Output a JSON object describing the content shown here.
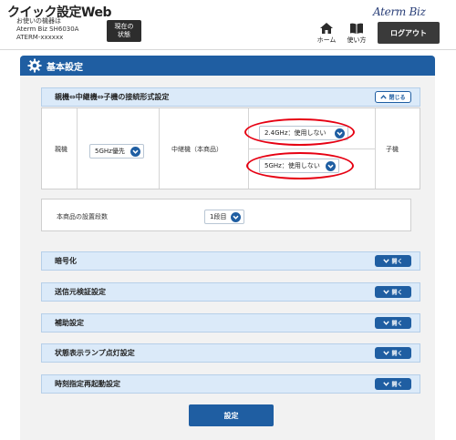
{
  "header": {
    "app_title": "クイック設定Web",
    "device_lines": [
      "お使いの機器は",
      "Aterm Biz SH6030A",
      "ATERM-xxxxxx"
    ],
    "status_button": [
      "現在の",
      "状態"
    ],
    "home_label": "ホーム",
    "manual_label": "使い方",
    "logout_label": "ログアウト",
    "brand": "Aterm Biz"
  },
  "section": {
    "title": "基本設定"
  },
  "connection": {
    "title": "親機⇔中継機⇔子機の接続形式設定",
    "close_label": "閉じる",
    "parent_label": "親機",
    "parent_select": "5GHz優先",
    "repeater_label": "中継機（本商品）",
    "band24_select": "2.4GHz：使用しない",
    "band5_select": "5GHz：使用しない",
    "child_label": "子機"
  },
  "stages": {
    "label": "本商品の設置段数",
    "select": "1段目"
  },
  "accordions": [
    {
      "label": "暗号化",
      "button": "開く"
    },
    {
      "label": "送信元検証設定",
      "button": "開く"
    },
    {
      "label": "補助設定",
      "button": "開く"
    },
    {
      "label": "状態表示ランプ点灯設定",
      "button": "開く"
    },
    {
      "label": "時刻指定再起動設定",
      "button": "開く"
    }
  ],
  "footer": {
    "submit_label": "設定"
  },
  "colors": {
    "primary_blue": "#1f5ea2",
    "accordion_bg": "#dbeaf9",
    "highlight_red": "#e60012",
    "dark_button": "#3a3a3a"
  }
}
